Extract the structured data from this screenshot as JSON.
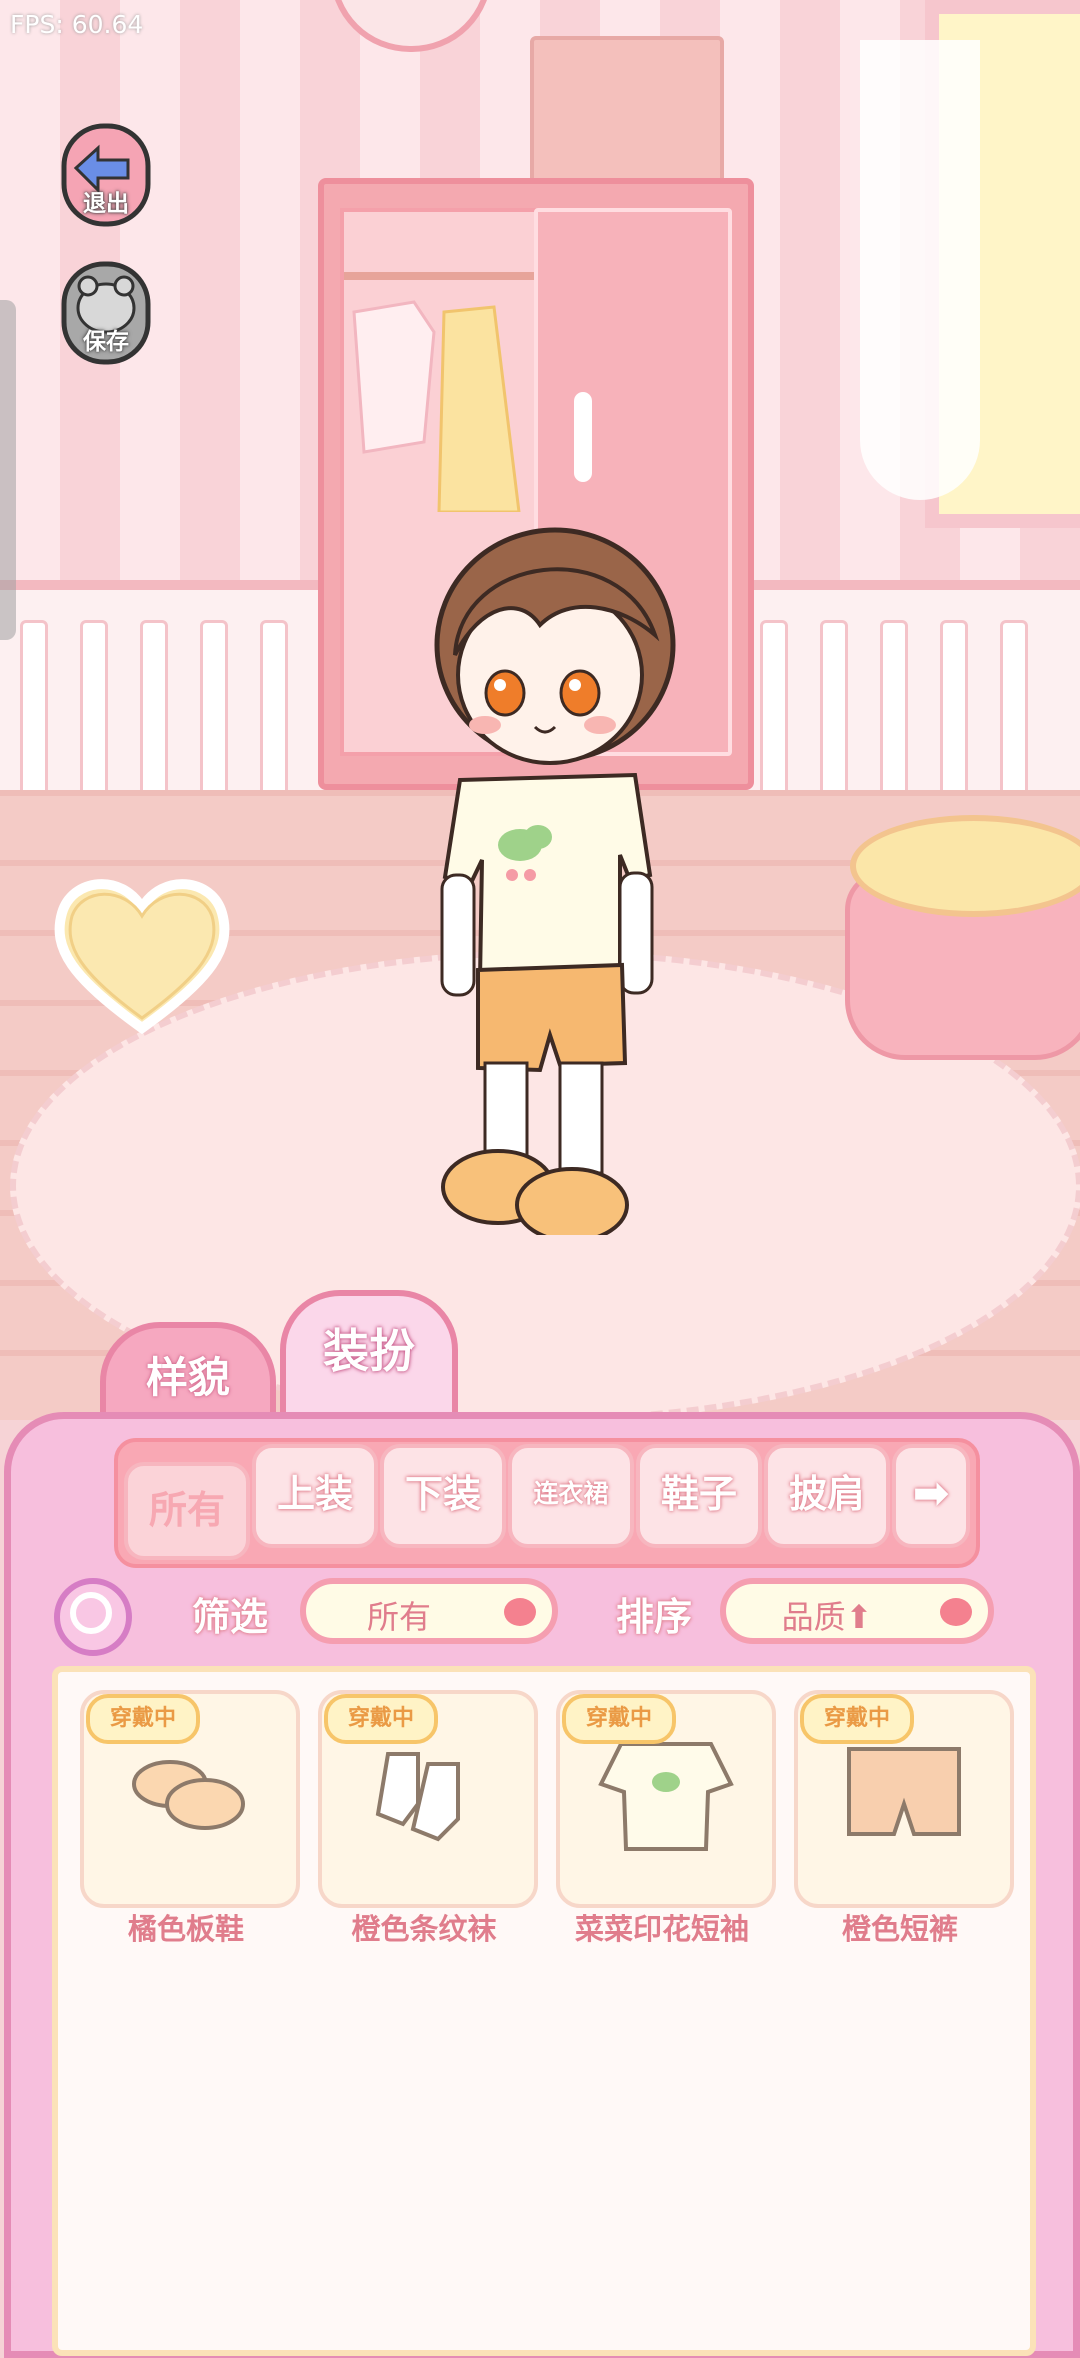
{
  "hud": {
    "fps": "FPS: 60.64"
  },
  "side_buttons": {
    "exit": "退出",
    "save": "保存"
  },
  "tabs": {
    "looks": "样貌",
    "dress": "装扮"
  },
  "categories": [
    "所有",
    "上装",
    "下装",
    "连衣裙",
    "鞋子",
    "披肩",
    "➡"
  ],
  "filter": {
    "label": "筛选",
    "value": "所有"
  },
  "sort": {
    "label": "排序",
    "value": "品质⬆"
  },
  "items": [
    {
      "badge": "穿戴中",
      "name": "橘色板鞋",
      "icon": "shoes-icon"
    },
    {
      "badge": "穿戴中",
      "name": "橙色条纹袜",
      "icon": "socks-icon"
    },
    {
      "badge": "穿戴中",
      "name": "菜菜印花短袖",
      "icon": "tshirt-icon"
    },
    {
      "badge": "穿戴中",
      "name": "橙色短裤",
      "icon": "shorts-icon"
    }
  ],
  "colors": {
    "panel": "#f7bfdd",
    "accent": "#e07d8c",
    "badge": "#ea9a45"
  }
}
